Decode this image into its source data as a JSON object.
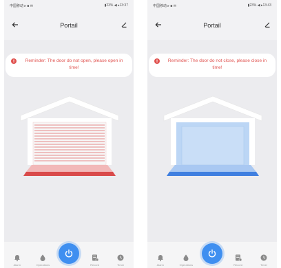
{
  "screens": [
    {
      "status": {
        "left": "中国移动 ▸ ■ ✉",
        "right": "▮23% ◀ ▸13:37"
      },
      "title": "Portail",
      "reminder": "Reminder: The door do not open, please open in time!",
      "door_state": "open",
      "nav": {
        "alarm": "Alarm",
        "operations": "Operations",
        "record": "Record",
        "timer": "Timer"
      }
    },
    {
      "status": {
        "left": "中国移动 ▸ ■ ✉",
        "right": "▮23% ◀ ▸13:43"
      },
      "title": "Portail",
      "reminder": "Reminder: The door do not close, please close in time!",
      "door_state": "closed",
      "nav": {
        "alarm": "Alarm",
        "operations": "Operations",
        "record": "Record",
        "timer": "Timer"
      }
    }
  ],
  "colors": {
    "reminder_text": "#e0524f",
    "open_floor": "#d94a4a",
    "closed_floor": "#3f7fe0",
    "closed_door": "#bcd6f5",
    "power": "#3f8ff0"
  },
  "icons": [
    "back-arrow-icon",
    "edit-pen-icon",
    "warning-icon",
    "bell-icon",
    "drop-icon",
    "power-icon",
    "record-icon",
    "clock-icon"
  ]
}
